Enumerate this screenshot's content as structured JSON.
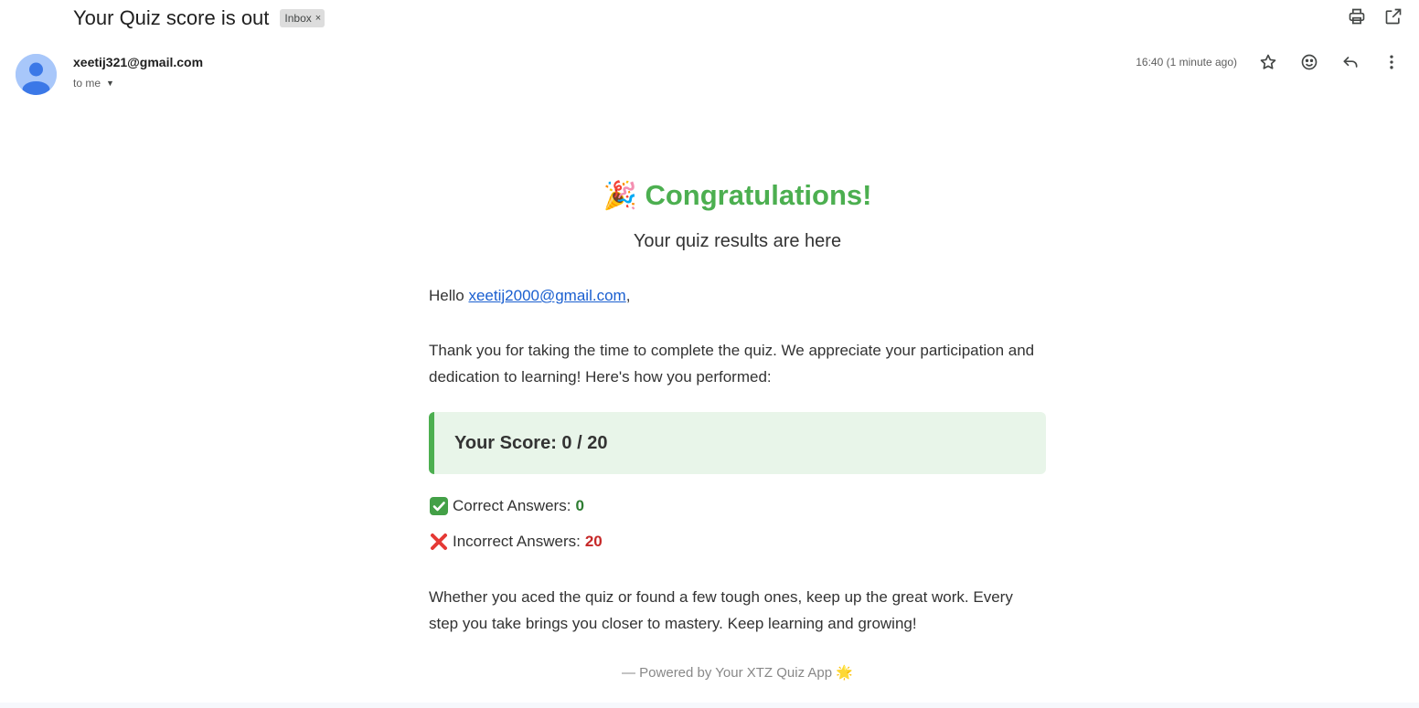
{
  "header": {
    "subject": "Your Quiz score is out",
    "label": "Inbox",
    "label_close": "×"
  },
  "sender": {
    "email": "xeetij321@gmail.com",
    "recipient": "to me",
    "timestamp": "16:40 (1 minute ago)"
  },
  "icons": {
    "print": "print-icon",
    "open_new_window": "open-in-new-window-icon",
    "star": "star-icon",
    "emoji": "emoji-reaction-icon",
    "reply": "reply-icon",
    "more": "more-vertical-icon"
  },
  "body": {
    "heading": "Congratulations!",
    "heading_emoji": "🎉",
    "subtitle": "Your quiz results are here",
    "greeting": "Hello ",
    "greeting_email": "xeetij2000@gmail.com",
    "greeting_suffix": ",",
    "intro": "Thank you for taking the time to complete the quiz. We appreciate your participation and dedication to learning! Here's how you performed:",
    "score_label": "Your Score: 0 / 20",
    "correct_label": "Correct Answers:",
    "correct_value": "0",
    "incorrect_label": "Incorrect Answers:",
    "incorrect_value": "20",
    "closing": "Whether you aced the quiz or found a few tough ones, keep up the great work. Every step you take brings you closer to mastery. Keep learning and growing!",
    "footer": "— Powered by Your XTZ Quiz App",
    "footer_emoji": "🌟"
  },
  "colors": {
    "accent_green": "#4caf50",
    "score_bg": "#e8f5e9",
    "correct": "#2e7d32",
    "incorrect": "#c62828",
    "link": "#1a5fd0"
  }
}
